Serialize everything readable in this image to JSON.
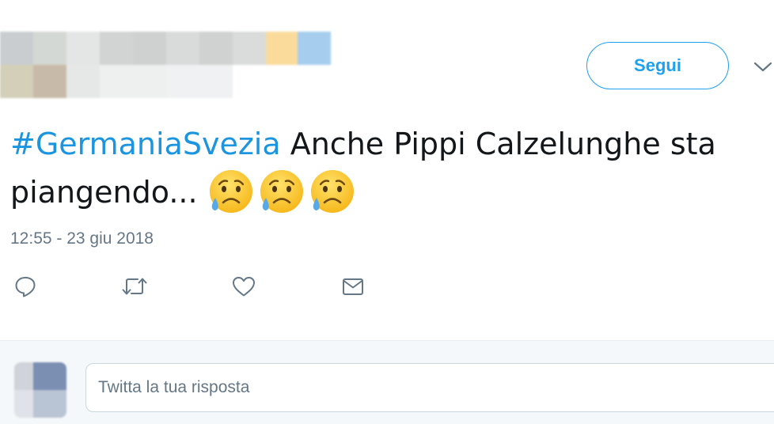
{
  "header": {
    "follow_label": "Segui"
  },
  "tweet": {
    "hashtag": "#GermaniaSvezia",
    "text_line1": " Anche Pippi Calzelunghe sta",
    "text_line2": "piangendo... ",
    "emoji_name": "sad-but-relieved-face-emoji",
    "emoji_count": 3,
    "timestamp": "12:55 - 23 giu 2018"
  },
  "actions": [
    "reply-icon",
    "retweet-icon",
    "like-icon",
    "direct-message-icon"
  ],
  "reply": {
    "placeholder": "Twitta la tua risposta"
  },
  "colors": {
    "accent": "#1da1f2",
    "hashtag": "#1b95e0",
    "text": "#14171a",
    "muted": "#657786",
    "reply_bar_bg": "#f5f8fa"
  }
}
